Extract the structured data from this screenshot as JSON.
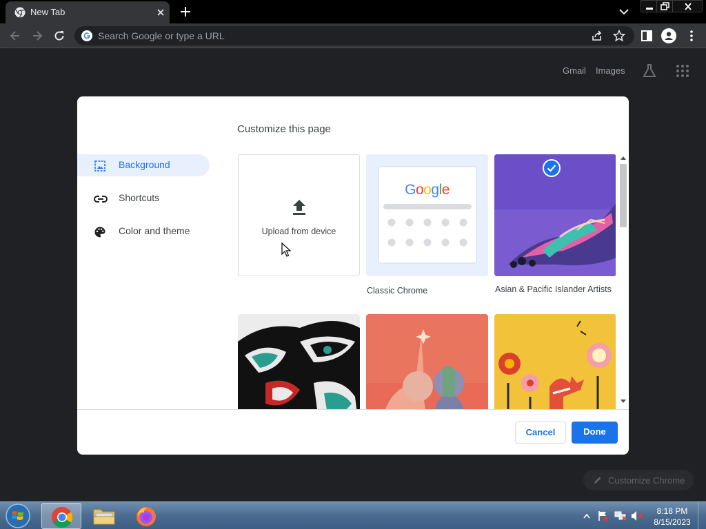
{
  "browser": {
    "tab_title": "New Tab",
    "omnibox_placeholder": "Search Google or type a URL"
  },
  "ntp": {
    "gmail_link": "Gmail",
    "images_link": "Images",
    "customize_chrome": "Customize Chrome"
  },
  "dialog": {
    "title": "Customize this page",
    "menu": [
      {
        "label": "Background",
        "icon": "image-icon",
        "selected": true
      },
      {
        "label": "Shortcuts",
        "icon": "link-icon",
        "selected": false
      },
      {
        "label": "Color and theme",
        "icon": "palette-icon",
        "selected": false
      }
    ],
    "upload_label": "Upload from device",
    "tiles": [
      {
        "label": "Classic Chrome",
        "selected": true
      },
      {
        "label": "Asian & Pacific Islander Artists",
        "selected": false
      }
    ],
    "classic_logo": "Google",
    "cancel_label": "Cancel",
    "done_label": "Done"
  },
  "taskbar": {
    "time": "8:18 PM",
    "date": "8/15/2023"
  },
  "colors": {
    "accent": "#1a73e8",
    "dark_bg": "#202124",
    "toolbar": "#35363a"
  }
}
